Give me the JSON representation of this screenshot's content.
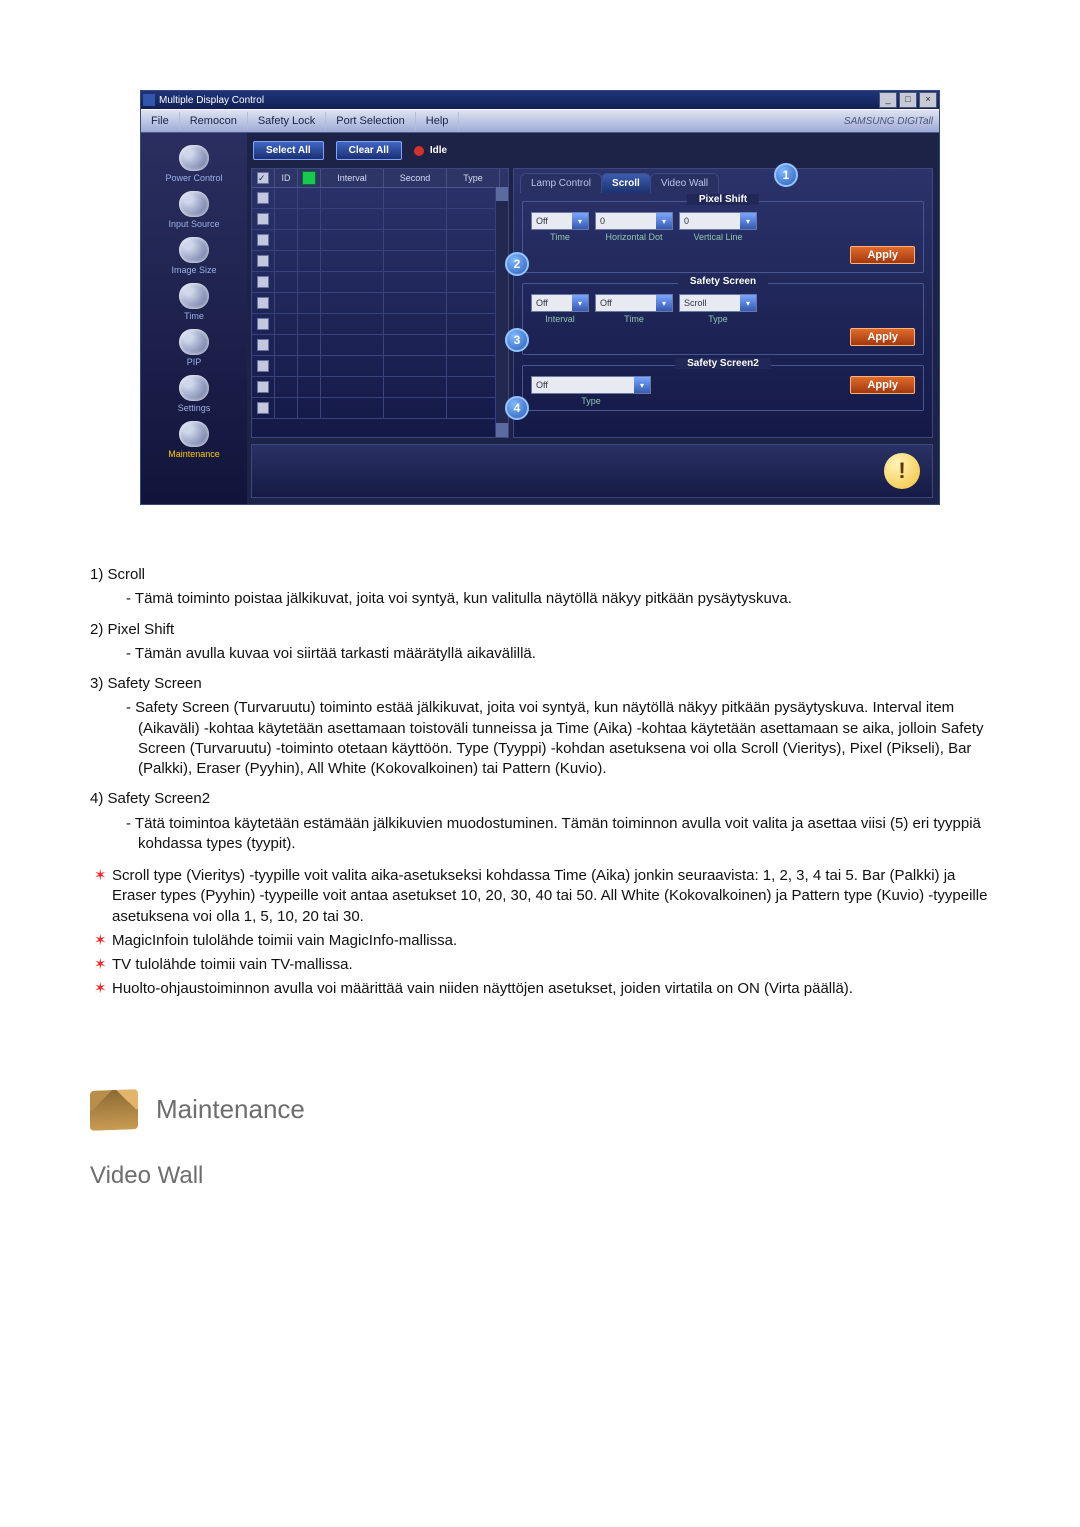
{
  "window": {
    "title": "Multiple Display Control",
    "brand": "SAMSUNG DIGITall"
  },
  "menu": {
    "file": "File",
    "remocon": "Remocon",
    "safety_lock": "Safety Lock",
    "port_selection": "Port Selection",
    "help": "Help"
  },
  "sidebar": {
    "items": [
      {
        "label": "Power Control"
      },
      {
        "label": "Input Source"
      },
      {
        "label": "Image Size"
      },
      {
        "label": "Time"
      },
      {
        "label": "PIP"
      },
      {
        "label": "Settings"
      },
      {
        "label": "Maintenance"
      }
    ]
  },
  "toolbar": {
    "select_all": "Select All",
    "clear_all": "Clear All",
    "idle": "Idle"
  },
  "grid": {
    "headers": {
      "c2": "ID",
      "c4": "Interval",
      "c5": "Second",
      "c6": "Type"
    }
  },
  "tabs": {
    "lamp": "Lamp Control",
    "scroll": "Scroll",
    "video_wall": "Video Wall"
  },
  "pixel_shift": {
    "legend": "Pixel Shift",
    "val1": "Off",
    "val2": "0",
    "val3": "0",
    "sub1": "Time",
    "sub2": "Horizontal Dot",
    "sub3": "Vertical Line",
    "apply": "Apply"
  },
  "safety_screen": {
    "legend": "Safety Screen",
    "val1": "Off",
    "val2": "Off",
    "val3": "Scroll",
    "sub1": "Interval",
    "sub2": "Time",
    "sub3": "Type",
    "apply": "Apply"
  },
  "safety_screen2": {
    "legend": "Safety Screen2",
    "val1": "Off",
    "sub1": "Type",
    "apply": "Apply"
  },
  "badges": {
    "n1": "1",
    "n2": "2",
    "n3": "3",
    "n4": "4"
  },
  "doc": {
    "i1": {
      "head": "1)  Scroll",
      "body": "Tämä toiminto poistaa jälkikuvat, joita voi syntyä, kun valitulla näytöllä näkyy pitkään pysäytyskuva."
    },
    "i2": {
      "head": "2)  Pixel Shift",
      "body": "Tämän avulla kuvaa voi siirtää tarkasti määrätyllä aikavälillä."
    },
    "i3": {
      "head": "3)  Safety Screen",
      "body": "Safety Screen (Turvaruutu) toiminto estää jälkikuvat, joita voi syntyä, kun näytöllä näkyy pitkään pysäytyskuva. Interval item (Aikaväli) -kohtaa käytetään asettamaan toistoväli tunneissa ja Time (Aika) -kohtaa käytetään asettamaan se aika, jolloin Safety Screen (Turvaruutu) -toiminto otetaan käyttöön. Type (Tyyppi) -kohdan asetuksena voi olla Scroll (Vieritys), Pixel (Pikseli), Bar (Palkki), Eraser (Pyyhin), All White (Kokovalkoinen) tai Pattern (Kuvio)."
    },
    "i4": {
      "head": "4)  Safety Screen2",
      "body": "Tätä toimintoa käytetään estämään jälkikuvien muodostuminen. Tämän toiminnon avulla voit valita ja asettaa viisi (5) eri tyyppiä kohdassa types (tyypit)."
    },
    "b1": "Scroll type (Vieritys) -tyypille voit valita aika-asetukseksi kohdassa Time (Aika) jonkin seuraavista: 1, 2, 3, 4 tai 5. Bar (Palkki) ja Eraser types (Pyyhin) -tyypeille voit antaa asetukset 10, 20, 30, 40 tai 50. All White (Kokovalkoinen) ja Pattern type (Kuvio) -tyypeille asetuksena voi olla 1, 5, 10, 20 tai 30.",
    "b2": "MagicInfoin tulolähde toimii vain MagicInfo-mallissa.",
    "b3": "TV tulolähde toimii vain TV-mallissa.",
    "b4": "Huolto-ohjaustoiminnon avulla voi määrittää vain niiden näyttöjen asetukset, joiden virtatila on ON (Virta päällä)."
  },
  "section": {
    "heading": "Maintenance",
    "subheading": "Video Wall"
  }
}
